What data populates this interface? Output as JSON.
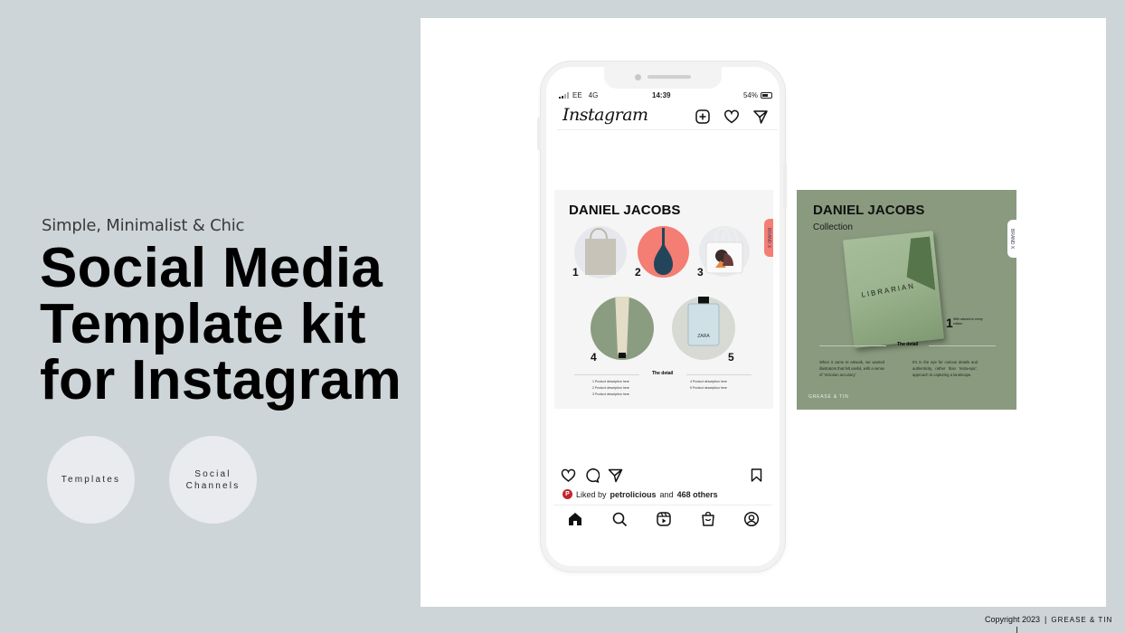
{
  "hero": {
    "tagline": "Simple, Minimalist & Chic",
    "headline_lines": [
      "Social Media",
      "Template kit",
      "for Instagram"
    ]
  },
  "pills": [
    {
      "label_lines": [
        "Templates"
      ]
    },
    {
      "label_lines": [
        "Social",
        "Channels"
      ]
    }
  ],
  "phone": {
    "status": {
      "carrier": "EE",
      "network": "4G",
      "time": "14:39",
      "battery": "54%"
    },
    "app_name": "Instagram",
    "header_icons": [
      "new-post-icon",
      "heart-icon",
      "direct-message-icon"
    ],
    "post": {
      "title": "DANIEL JACOBS",
      "brand_tab": "BRAND X",
      "products": [
        {
          "number": "1",
          "item": "canvas tote bag",
          "bg": "#e7e8ee"
        },
        {
          "number": "2",
          "item": "blue vase",
          "bg": "#f47d74"
        },
        {
          "number": "3",
          "item": "illustrated tote bag",
          "bg": "#e9eaee"
        },
        {
          "number": "4",
          "item": "cream tube",
          "bg": "#8b9d81"
        },
        {
          "number": "5",
          "item": "perfume bottle",
          "bg": "#d7d9d3"
        }
      ],
      "detail_label": "The detail",
      "descriptions_left": [
        "1 Product description here",
        "2 Product description here",
        "3 Product description here"
      ],
      "descriptions_right": [
        "4 Product description here",
        "5 Product description here"
      ]
    },
    "likes": {
      "avatar_letter": "P",
      "prefix": "Liked by",
      "user": "petrolicious",
      "middle": "and",
      "count": "468 others"
    },
    "post_actions": [
      "like-icon",
      "comment-icon",
      "share-icon",
      "save-icon"
    ],
    "tabbar": [
      "home-icon",
      "search-icon",
      "reels-icon",
      "shop-icon",
      "profile-icon"
    ]
  },
  "post2": {
    "title": "DANIEL JACOBS",
    "subtitle": "Collection",
    "brand_tab": "BRAND X",
    "bag_text": "LIBRARIAN",
    "feature_number": "1",
    "feature_text": "With artwork in every edition",
    "detail_label": "The detail",
    "paragraph_left": "When it came to artwork, we wanted illustrators that felt useful, with a sense of 'Victorian accuracy'",
    "paragraph_right": "It's in the eye for curious details and authenticity, rather than 'insta-epic', approach to capturing a landscape.",
    "logo": "GREASE & TIN"
  },
  "footer": {
    "copyright": "Copyright 2023",
    "separator": "|",
    "brand": "GREASE & TIN"
  },
  "colors": {
    "background": "#cdd5d8",
    "canvas": "#ffffff",
    "sage": "#8a9a7f",
    "coral": "#f47d74",
    "pill": "#e9ebee"
  }
}
